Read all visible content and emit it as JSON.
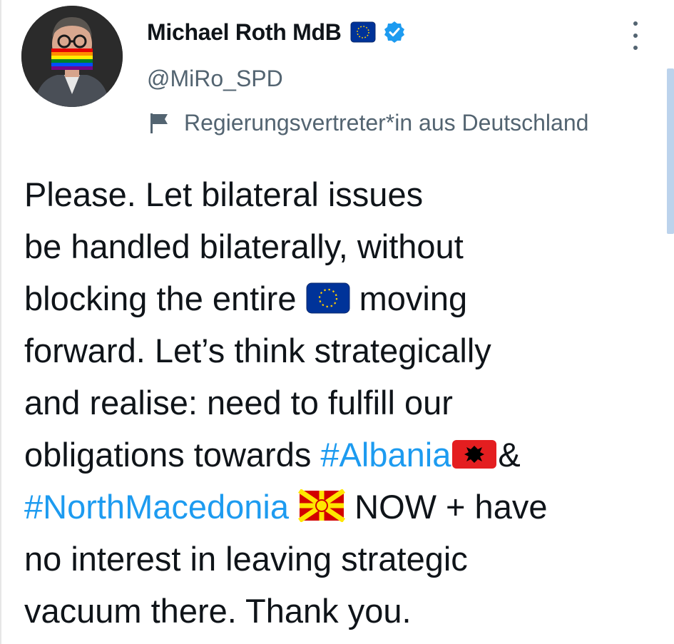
{
  "author": {
    "display_name": "Michael Roth MdB",
    "handle": "@MiRo_SPD",
    "account_label": "Regierungsvertreter*in aus Deutschland",
    "name_emoji": "eu-flag-icon",
    "verified_icon": "verified-badge-icon"
  },
  "menu": {
    "more_icon": "more-options-icon"
  },
  "tweet": {
    "line1": "Please. Let bilateral issues",
    "line2": "be handled bilaterally, without",
    "line3a": "blocking the entire",
    "line3b": "moving",
    "line4": "forward. Let’s think strategically",
    "line5": "and realise: need to fulfill our",
    "line6a": "obligations towards",
    "hashtag_albania": "#Albania",
    "line6b": "&",
    "hashtag_north_macedonia": "#NorthMacedonia",
    "line7b": "NOW + have",
    "line8": "no interest in leaving strategic",
    "line9": "vacuum there. Thank you.",
    "emojis": [
      "eu-flag-icon",
      "albania-flag-icon",
      "north-macedonia-flag-icon"
    ]
  },
  "colors": {
    "hashtag": "#1d9bf0",
    "secondary_text": "#536471",
    "verified": "#1d9bf0",
    "eu_blue": "#003399",
    "eu_gold": "#ffcc00"
  }
}
